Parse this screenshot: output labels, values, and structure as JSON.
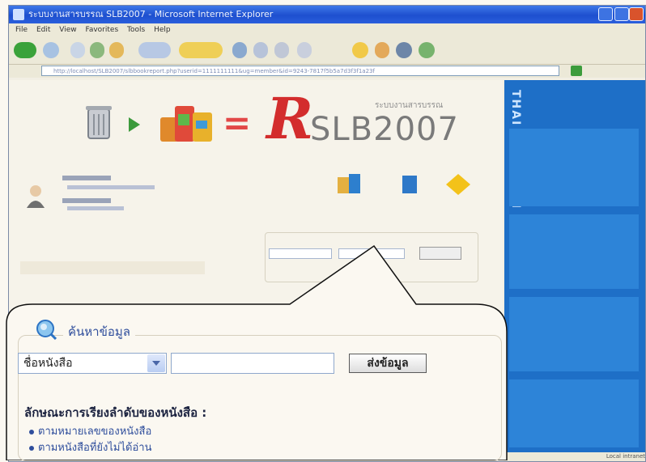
{
  "browser": {
    "title": "ระบบงานสารบรรณ SLB2007 - Microsoft Internet Explorer",
    "menu": [
      "File",
      "Edit",
      "View",
      "Favorites",
      "Tools",
      "Help"
    ],
    "address": "http://localhost/SLB2007/slbbookreport.php?userid=1111111111&ug=member&id=9243-7817f5b5a7d3f3f1a23f"
  },
  "logo": {
    "name": "SLB2007",
    "subtitle": "ระบบงานสารบรรณ"
  },
  "sidebar_panel": {
    "vertical_text": "THAI AUSTRIAN",
    "status": "Local intranet"
  },
  "search": {
    "title": "ค้นหาข้อมูล",
    "select_value": "ชื่อหนังสือ",
    "input_value": "",
    "button_label": "ส่งข้อมูล"
  },
  "order": {
    "title": "ลักษณะการเรียงลำดับของหนังสือ :",
    "items": [
      "ตามหมายเลขของหนังสือ",
      "ตามหนังสือที่ยังไม่ได้อ่าน"
    ]
  },
  "colors": {
    "accent": "#2f4e9c",
    "panel_blue": "#1e6fc7",
    "logo_red": "#d32d2d"
  }
}
